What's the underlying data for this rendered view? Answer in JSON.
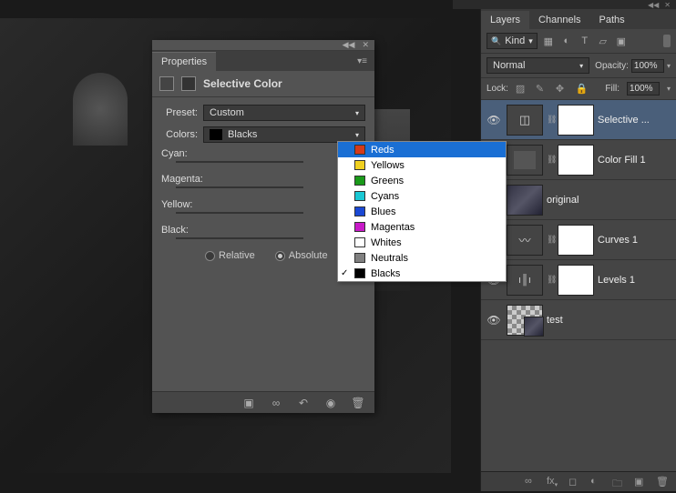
{
  "properties": {
    "panel_title": "Properties",
    "adjustment_title": "Selective Color",
    "preset_label": "Preset:",
    "preset_value": "Custom",
    "colors_label": "Colors:",
    "colors_value": "Blacks",
    "sliders": {
      "cyan": "Cyan:",
      "magenta": "Magenta:",
      "yellow": "Yellow:",
      "black": "Black:"
    },
    "mode": {
      "relative": "Relative",
      "absolute": "Absolute",
      "selected": "absolute"
    },
    "footer_icons": [
      "clip-icon",
      "link-icon",
      "reset-icon",
      "visibility-icon",
      "delete-icon"
    ]
  },
  "color_dropdown": {
    "options": [
      {
        "label": "Reds",
        "swatch": "#d43a1a",
        "selected": true
      },
      {
        "label": "Yellows",
        "swatch": "#f0d020"
      },
      {
        "label": "Greens",
        "swatch": "#1a9a1a"
      },
      {
        "label": "Cyans",
        "swatch": "#1ac8d4"
      },
      {
        "label": "Blues",
        "swatch": "#1a48d4"
      },
      {
        "label": "Magentas",
        "swatch": "#c81ac8"
      },
      {
        "label": "Whites",
        "swatch": "#ffffff"
      },
      {
        "label": "Neutrals",
        "swatch": "#808080"
      },
      {
        "label": "Blacks",
        "swatch": "#000000",
        "checked": true
      }
    ]
  },
  "layers_panel": {
    "tabs": [
      "Layers",
      "Channels",
      "Paths"
    ],
    "active_tab": "Layers",
    "kind_label": "Kind",
    "filter_icons": [
      "image-filter-icon",
      "adjustment-filter-icon",
      "type-filter-icon",
      "shape-filter-icon",
      "smart-filter-icon"
    ],
    "blend_mode": "Normal",
    "opacity_label": "Opacity:",
    "opacity_value": "100%",
    "lock_label": "Lock:",
    "lock_icons": [
      "lock-transparent-icon",
      "lock-image-icon",
      "lock-position-icon",
      "lock-all-icon"
    ],
    "fill_label": "Fill:",
    "fill_value": "100%",
    "layers": [
      {
        "visible": true,
        "name": "Selective ...",
        "thumb": "adj",
        "mask": true,
        "link": true,
        "active": true
      },
      {
        "visible": false,
        "name": "Color Fill 1",
        "thumb": "solid",
        "mask": true,
        "link": true
      },
      {
        "visible": true,
        "name": "original",
        "thumb": "img",
        "mask": false
      },
      {
        "visible": true,
        "name": "Curves 1",
        "thumb": "adj-curves",
        "mask": true,
        "link": true
      },
      {
        "visible": true,
        "name": "Levels 1",
        "thumb": "adj-levels",
        "mask": true,
        "link": true
      },
      {
        "visible": true,
        "name": "test",
        "thumb": "checker-img",
        "mask": false
      }
    ],
    "footer_icons": [
      "link-icon",
      "fx-icon",
      "mask-icon",
      "adjustment-icon",
      "group-icon",
      "new-layer-icon",
      "delete-icon"
    ]
  }
}
